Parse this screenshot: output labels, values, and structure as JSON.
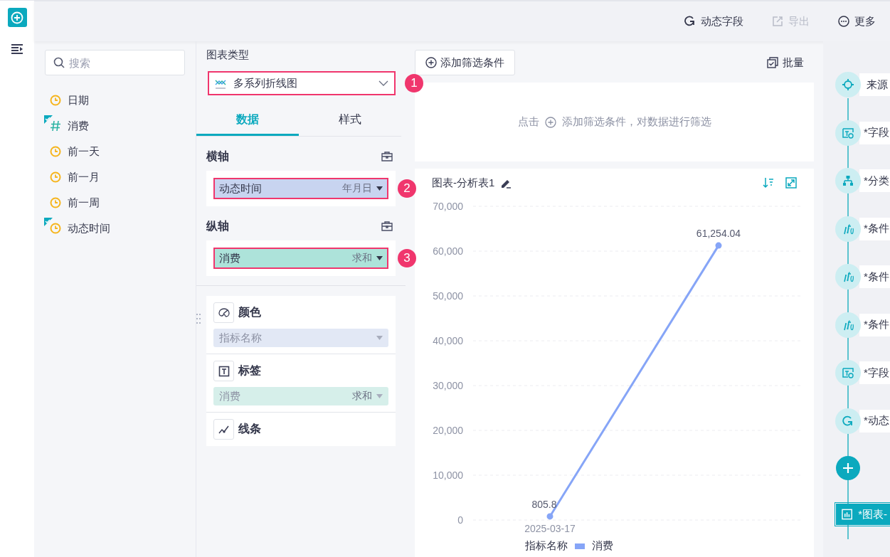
{
  "toolbar": {
    "actions": [
      {
        "label": "动态字段",
        "kind": "dynamic",
        "disabled": false
      },
      {
        "label": "导出",
        "kind": "export",
        "disabled": true
      },
      {
        "label": "更多",
        "kind": "more",
        "disabled": false
      }
    ]
  },
  "field_list": {
    "search": {
      "placeholder": "搜索"
    },
    "fields": [
      {
        "name": "日期",
        "kind": "date",
        "used": false
      },
      {
        "name": "消费",
        "kind": "number",
        "used": true
      },
      {
        "name": "前一天",
        "kind": "date",
        "used": false
      },
      {
        "name": "前一月",
        "kind": "date",
        "used": false
      },
      {
        "name": "前一周",
        "kind": "date",
        "used": false
      },
      {
        "name": "动态时间",
        "kind": "date",
        "used": true
      }
    ]
  },
  "config": {
    "chart_type_label": "图表类型",
    "chart_type": {
      "value": "多系列折线图",
      "annotation": "1"
    },
    "tabs": [
      {
        "label": "数据",
        "selected": true
      },
      {
        "label": "样式",
        "selected": false
      }
    ],
    "axes": [
      {
        "title": "横轴",
        "field": {
          "name": "动态时间",
          "kind": "dimension",
          "aggregation": "年月日"
        },
        "annotation": "2"
      },
      {
        "title": "纵轴",
        "field": {
          "name": "消费",
          "kind": "measure",
          "aggregation": "求和"
        },
        "annotation": "3"
      }
    ],
    "properties": [
      {
        "kind": "color",
        "title": "颜色",
        "field": {
          "name": "指标名称",
          "kind": "dimension"
        }
      },
      {
        "kind": "label",
        "title": "标签",
        "field": {
          "name": "消费",
          "kind": "measure",
          "aggregation": "求和"
        }
      },
      {
        "kind": "line",
        "title": "线条"
      }
    ]
  },
  "filter": {
    "add_button": "添加筛选条件",
    "batch_button": "批量",
    "hint_prefix": "点击",
    "hint_text": "添加筛选条件，对数据进行筛选"
  },
  "chart_card": {
    "title": "图表-分析表1",
    "legend_title": "指标名称",
    "chart_data": {
      "type": "line",
      "categories": [
        "2025-03-17",
        null
      ],
      "series": [
        {
          "name": "消费",
          "color": "#86a5f7",
          "marker": "circle",
          "values": [
            805.8,
            61254.04
          ]
        }
      ],
      "grid": true,
      "ylim": [
        0,
        70000
      ],
      "yticks": [
        {
          "value": 0,
          "label": "0"
        },
        {
          "value": 10000,
          "label": "10,000"
        },
        {
          "value": 20000,
          "label": "20,000"
        },
        {
          "value": 30000,
          "label": "30,000"
        },
        {
          "value": 40000,
          "label": "40,000"
        },
        {
          "value": 50000,
          "label": "50,000"
        },
        {
          "value": 60000,
          "label": "60,000"
        },
        {
          "value": 70000,
          "label": "70,000"
        }
      ],
      "value_labels": [
        "805.8",
        "61,254.04"
      ]
    }
  },
  "flow": {
    "steps": [
      {
        "label": "来源",
        "kind": "source"
      },
      {
        "label": "*字段",
        "kind": "field"
      },
      {
        "label": "*分类",
        "kind": "group"
      },
      {
        "label": "*条件",
        "kind": "condition"
      },
      {
        "label": "*条件",
        "kind": "condition"
      },
      {
        "label": "*条件",
        "kind": "condition"
      },
      {
        "label": "*字段",
        "kind": "field"
      },
      {
        "label": "*动态",
        "kind": "dynamic"
      }
    ],
    "final": {
      "label": "*图表-",
      "kind": "chart"
    }
  }
}
